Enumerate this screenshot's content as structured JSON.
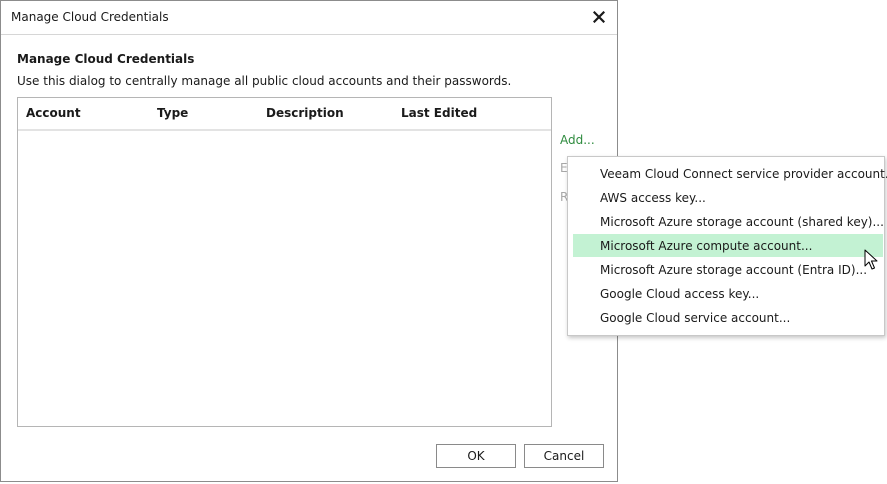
{
  "window": {
    "title": "Manage Cloud Credentials",
    "close_icon": "close-icon"
  },
  "content": {
    "heading": "Manage Cloud Credentials",
    "description": "Use this dialog to centrally manage all public cloud accounts and their passwords."
  },
  "table": {
    "columns": [
      "Account",
      "Type",
      "Description",
      "Last Edited"
    ],
    "rows": []
  },
  "side_actions": {
    "add": "Add...",
    "edit_partial": "E",
    "remove_partial": "R"
  },
  "add_menu": {
    "items": [
      "Veeam Cloud Connect service provider account...",
      "AWS access key...",
      "Microsoft Azure storage account (shared key)...",
      "Microsoft Azure compute account...",
      "Microsoft Azure storage account (Entra ID)...",
      "Google Cloud access key...",
      "Google Cloud service account..."
    ],
    "highlighted": "Microsoft Azure compute account..."
  },
  "footer": {
    "ok": "OK",
    "cancel": "Cancel"
  },
  "colors": {
    "accent_link": "#2e8b3e",
    "menu_highlight": "#c3f2d3",
    "disabled_text": "#a8a8a8"
  }
}
